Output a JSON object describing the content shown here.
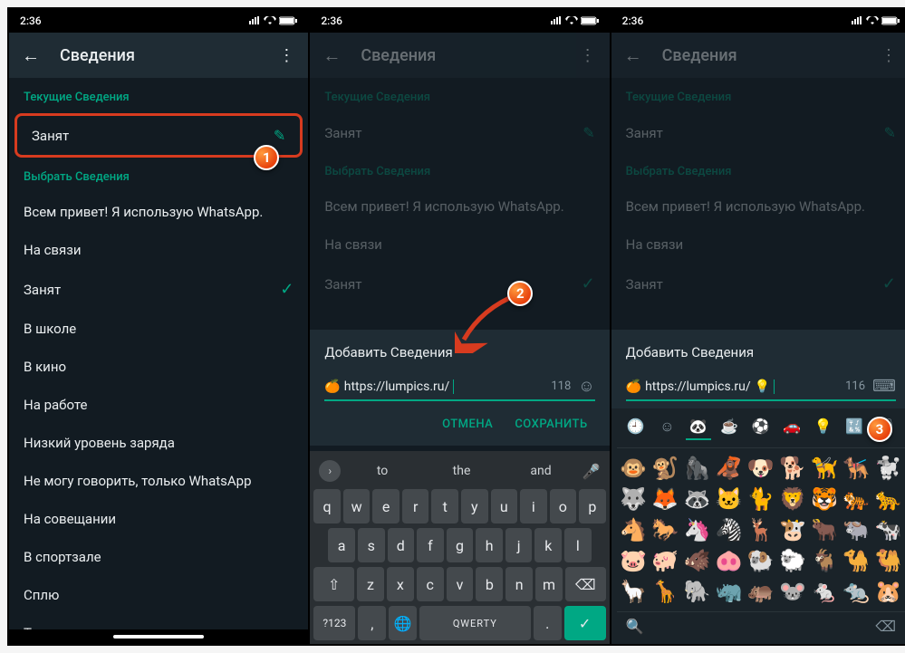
{
  "statusbar": {
    "time": "2:36"
  },
  "appbar": {
    "title": "Сведения"
  },
  "sections": {
    "current_header": "Текущие Сведения",
    "current_status": "Занят",
    "select_header": "Выбрать Сведения",
    "options": [
      "Всем привет! Я использую WhatsApp.",
      "На связи",
      "Занят",
      "В школе",
      "В кино",
      "На работе",
      "Низкий уровень заряда",
      "Не могу говорить, только WhatsApp",
      "На совещании",
      "В спортзале",
      "Сплю",
      "Только экстренные звонки"
    ]
  },
  "dialog": {
    "title": "Добавить Сведения",
    "input_emoji": "🍊",
    "input_text": "https://lumpics.ru/",
    "input_extra": "💡",
    "counter_p2": "118",
    "counter_p3": "116",
    "cancel": "ОТМЕНА",
    "save": "СОХРАНИТЬ"
  },
  "keyboard": {
    "suggestions": [
      "to",
      "the",
      "and"
    ],
    "row1": [
      "q",
      "w",
      "e",
      "r",
      "t",
      "y",
      "u",
      "i",
      "o",
      "p"
    ],
    "row2": [
      "a",
      "s",
      "d",
      "f",
      "g",
      "h",
      "j",
      "k",
      "l"
    ],
    "row3_mid": [
      "z",
      "x",
      "c",
      "v",
      "b",
      "n",
      "m"
    ],
    "space_label": "QWERTY",
    "sym_label": "?123"
  },
  "emoji_panel": {
    "tabs": [
      "🕘",
      "☺",
      "🐼",
      "☕",
      "⚽",
      "🚗",
      "💡",
      "🔣",
      "🏳"
    ],
    "grid": [
      "🐵",
      "🐒",
      "🦍",
      "🦧",
      "🐶",
      "🐕",
      "🦮",
      "🐕‍🦺",
      "🐩",
      "🐺",
      "🦊",
      "🦝",
      "🐱",
      "🐈",
      "🦁",
      "🐯",
      "🐅",
      "🐆",
      "🐴",
      "🐎",
      "🦄",
      "🦓",
      "🦌",
      "🐮",
      "🐂",
      "🐃",
      "🐄",
      "🐷",
      "🐖",
      "🐗",
      "🐽",
      "🐏",
      "🐑",
      "🐐",
      "🐪",
      "🐫",
      "🦙",
      "🦒",
      "🐘",
      "🦏",
      "🦛",
      "🐭",
      "🐁",
      "🐀",
      "🐹"
    ]
  },
  "badges": {
    "one": "1",
    "two": "2",
    "three": "3"
  }
}
